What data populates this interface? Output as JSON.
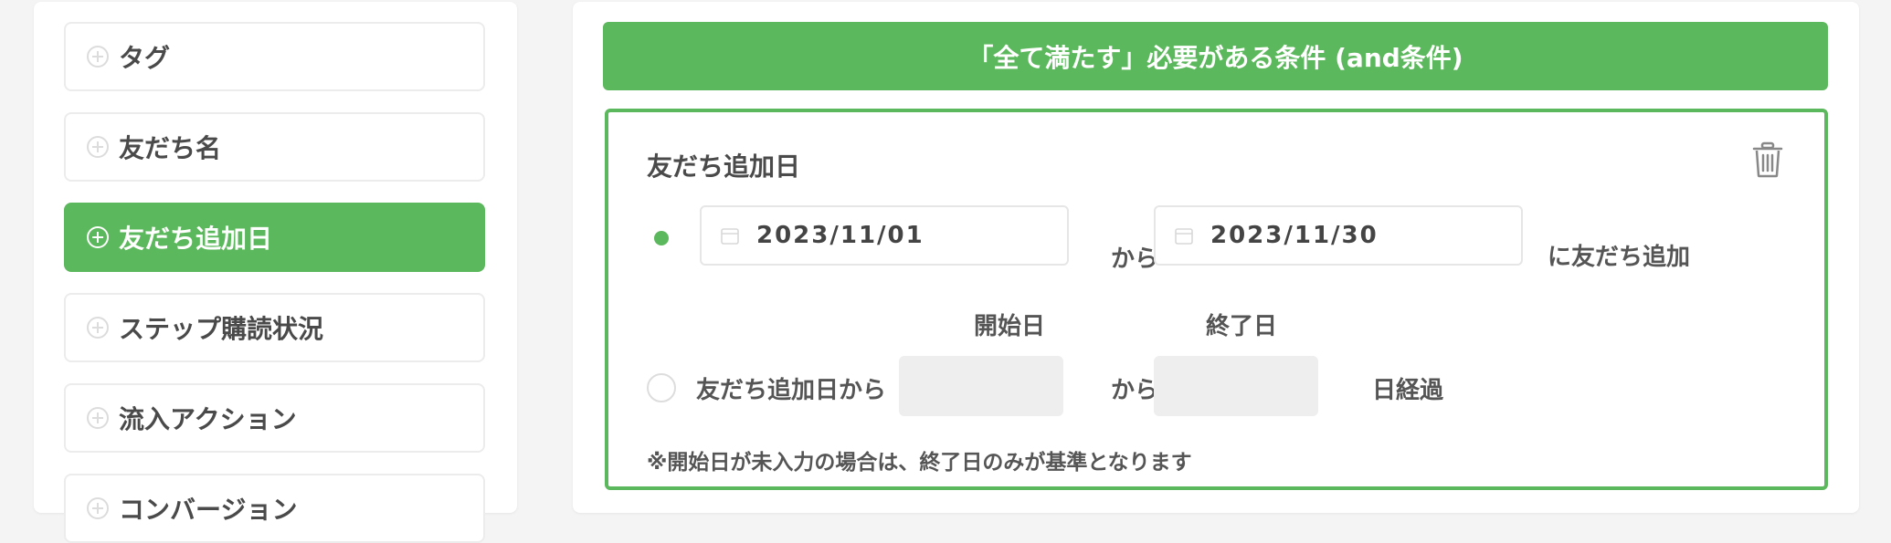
{
  "sidebar": {
    "items": [
      {
        "label": "タグ",
        "active": false
      },
      {
        "label": "友だち名",
        "active": false
      },
      {
        "label": "友だち追加日",
        "active": true
      },
      {
        "label": "ステップ購読状況",
        "active": false
      },
      {
        "label": "流入アクション",
        "active": false
      },
      {
        "label": "コンバージョン",
        "active": false
      }
    ]
  },
  "main": {
    "banner": "「全て満たす」必要がある条件 (and条件)",
    "panel": {
      "title": "友だち追加日",
      "range_option": {
        "start_date": "2023/11/01",
        "from_label": "から",
        "end_date": "2023/11/30",
        "suffix": "に友だち追加",
        "selected": true
      },
      "elapsed_option": {
        "start_header": "開始日",
        "end_header": "終了日",
        "prefix": "友だち追加日から",
        "from_label": "から",
        "suffix": "日経過",
        "start_value": "",
        "end_value": "",
        "selected": false
      },
      "note": "※開始日が未入力の場合は、終了日のみが基準となります"
    }
  },
  "colors": {
    "accent": "#5cb85c",
    "background": "#f4f4f4",
    "input_disabled": "#eeeeee"
  },
  "icons": {
    "sidebar_item": "plus-circle-icon",
    "delete": "trash-icon",
    "date": "calendar-icon"
  }
}
